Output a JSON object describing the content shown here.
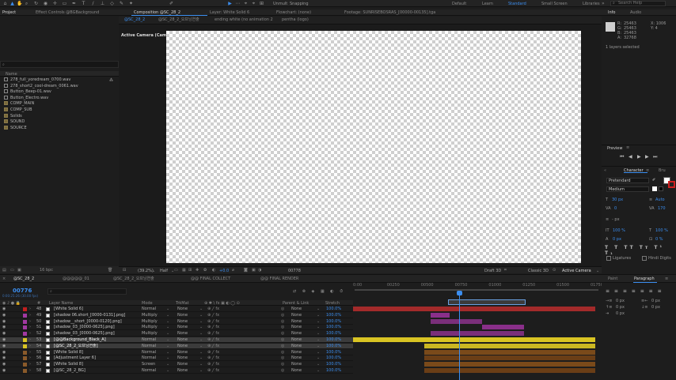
{
  "toolbar": {
    "unmult": "Unmult",
    "snapping": "Snapping",
    "workspaces": [
      "Default",
      "Learn",
      "Standard",
      "Small Screen",
      "Libraries"
    ],
    "active_workspace": "Standard",
    "search_placeholder": "Search Help"
  },
  "top_tabs": {
    "project": "Project",
    "effect_controls": "Effect Controls @BGBackground",
    "composition": "Composition @SC_28_2",
    "layer": "Layer: White Solid 6",
    "flowchart": "Flowchart: (none)",
    "footage": "Footage: SUNRISEBOSRAS_[00000-00135].tga",
    "info": "Info",
    "audio": "Audio"
  },
  "comp_subtabs": [
    "@SC_28_2",
    "@SC_28_2_오프닝연출",
    "ending white (no animation 2",
    "pentha (logo)"
  ],
  "viewer": {
    "active_camera": "Active Camera (Camera 1)",
    "zoom": "(39.2%)",
    "quality": "Half",
    "timecode": "00778",
    "draft": "Draft 3D",
    "renderer": "Classic 3D",
    "view": "Active Camera",
    "views": "1 View",
    "exposure": "+0.0"
  },
  "project": {
    "search_placeholder": "",
    "col_name": "Name",
    "items": [
      {
        "name": "278_full_yoredream_0700.wav",
        "kind": "audio"
      },
      {
        "name": "278_short2_cool-dream_0061.wav",
        "kind": "audio"
      },
      {
        "name": "Button_Beep-01.wav",
        "kind": "audio"
      },
      {
        "name": "Button_Electro.wav",
        "kind": "audio"
      },
      {
        "name": "COMP_MAIN",
        "kind": "folder"
      },
      {
        "name": "COMP_SUB",
        "kind": "folder"
      },
      {
        "name": "Solids",
        "kind": "folder"
      },
      {
        "name": "SOUND",
        "kind": "folder"
      },
      {
        "name": "SOURCE",
        "kind": "folder"
      }
    ],
    "bpc": "16 bpc"
  },
  "info": {
    "r": "R:",
    "g": "G:",
    "b": "B:",
    "a": "A:",
    "rv": "25463",
    "gv": "25463",
    "bv": "25463",
    "av": "32768",
    "x": "X: 1006",
    "y": "Y: 4",
    "status": "1 layers selected"
  },
  "preview": {
    "title": "Preview"
  },
  "character": {
    "title": "Character",
    "font": "Pretendard",
    "style": "Medium",
    "size": "30 px",
    "leading": "Auto",
    "kerning": "0",
    "tracking": "170",
    "unit": "- px",
    "vscale": "100 %",
    "hscale": "100 %",
    "baseline": "0 px",
    "tsume": "0 %",
    "ligatures": "Ligatures",
    "hindi": "Hindi Digits"
  },
  "paragraph": {
    "paint": "Paint",
    "title": "Paragraph",
    "indent_left": "0 px",
    "indent_right": "0 px",
    "space_before": "0 px",
    "space_after": "0 px",
    "first_line": "0 px"
  },
  "timeline": {
    "tabs": [
      "@SC_28_2",
      "@@@@@_01",
      "@SC_28_2_오프닝연출",
      "@@ FINAL COLLECT",
      "@@ FINAL RENDER"
    ],
    "timecode": "00776",
    "fps": "0:00:25:26 (30.00 fps)",
    "headers": {
      "num": "#",
      "name": "Layer Name",
      "mode": "Mode",
      "trkmat": "TrkMat",
      "parent": "Parent & Link",
      "stretch": "Stretch"
    },
    "ruler": [
      "0:00",
      "00250",
      "00500",
      "00750",
      "01000",
      "01250",
      "01500",
      "01750"
    ],
    "layers": [
      {
        "num": "48",
        "name": "[White Solid 6]",
        "mode": "Normal",
        "trkmat": "None",
        "parent": "None",
        "stretch": "100.0%",
        "color": "#c21f1f",
        "selected": false
      },
      {
        "num": "49",
        "name": "[shadow 06.short_[0000-0131].png]",
        "mode": "Multiply",
        "trkmat": "None",
        "parent": "None",
        "stretch": "100.0%",
        "color": "#a239a2",
        "selected": false
      },
      {
        "num": "50",
        "name": "[shadow__short_[0000-0120].png]",
        "mode": "Multiply",
        "trkmat": "None",
        "parent": "None",
        "stretch": "100.0%",
        "color": "#a239a2",
        "selected": false
      },
      {
        "num": "51",
        "name": "[shadow_03_[0000-0625].png]",
        "mode": "Multiply",
        "trkmat": "None",
        "parent": "None",
        "stretch": "100.0%",
        "color": "#a239a2",
        "selected": false
      },
      {
        "num": "52",
        "name": "[shadow_03_[0000-0625].png]",
        "mode": "Multiply",
        "trkmat": "None",
        "parent": "None",
        "stretch": "100.0%",
        "color": "#a239a2",
        "selected": false
      },
      {
        "num": "53",
        "name": "[@@Background_Black_A]",
        "mode": "Normal",
        "trkmat": "None",
        "parent": "None",
        "stretch": "100.0%",
        "color": "#d9c423",
        "selected": true
      },
      {
        "num": "54",
        "name": "[@SC_28_2_오프닝연출]",
        "mode": "Normal",
        "trkmat": "None",
        "parent": "None",
        "stretch": "100.0%",
        "color": "#d9c423",
        "selected": true
      },
      {
        "num": "55",
        "name": "[White Solid 8]",
        "mode": "Normal",
        "trkmat": "None",
        "parent": "None",
        "stretch": "100.0%",
        "color": "#8a5a2a",
        "selected": false
      },
      {
        "num": "56",
        "name": "[Adjustment Layer 6]",
        "mode": "Normal",
        "trkmat": "None",
        "parent": "None",
        "stretch": "100.0%",
        "color": "#8a5a2a",
        "selected": false
      },
      {
        "num": "57",
        "name": "[White Solid 8]",
        "mode": "Screen",
        "trkmat": "None",
        "parent": "None",
        "stretch": "100.0%",
        "color": "#8a5a2a",
        "selected": false
      },
      {
        "num": "58",
        "name": "[@SC_28_2_BG]",
        "mode": "Normal",
        "trkmat": "None",
        "parent": "None",
        "stretch": "100.0%",
        "color": "#8a5a2a",
        "selected": false
      }
    ],
    "bars": [
      {
        "start": 0.0,
        "end": 0.75,
        "color": "#a32a2a"
      },
      {
        "start": 0.24,
        "end": 0.3,
        "color": "#8a2f8a"
      },
      {
        "start": 0.24,
        "end": 0.4,
        "color": "#7a2f7a"
      },
      {
        "start": 0.4,
        "end": 0.53,
        "color": "#8a2f8a"
      },
      {
        "start": 0.24,
        "end": 0.53,
        "color": "#7a2f7a"
      },
      {
        "start": 0.0,
        "end": 0.75,
        "color": "#d9c423"
      },
      {
        "start": 0.22,
        "end": 0.75,
        "color": "#cbb722"
      },
      {
        "start": 0.22,
        "end": 0.75,
        "color": "#7a4a1a"
      },
      {
        "start": 0.22,
        "end": 0.75,
        "color": "#6a3e16"
      },
      {
        "start": 0.22,
        "end": 0.75,
        "color": "#7a4a1a"
      },
      {
        "start": 0.22,
        "end": 0.75,
        "color": "#6a3e16"
      }
    ],
    "playhead": 0.328
  }
}
